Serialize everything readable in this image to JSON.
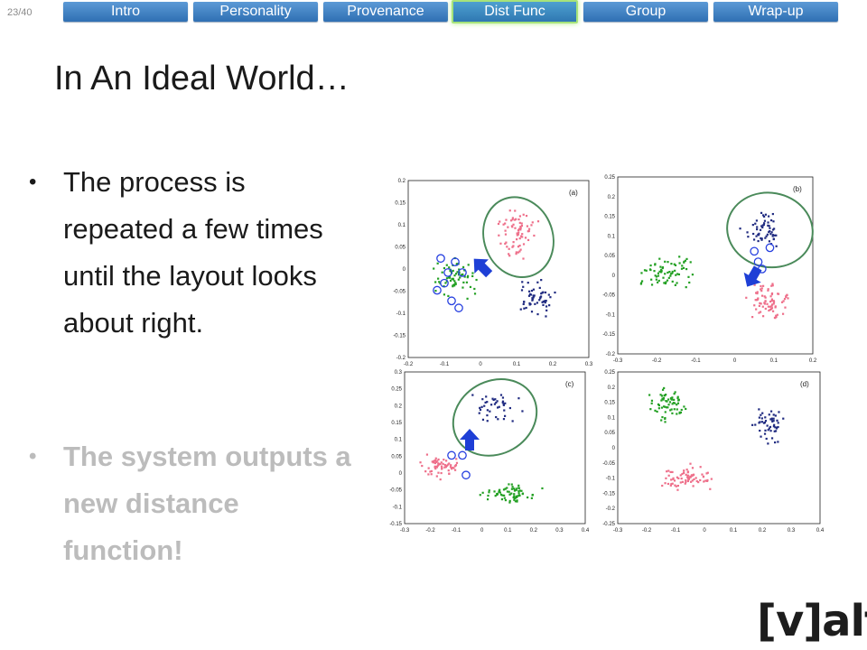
{
  "slide_number": "23/40",
  "nav": {
    "tabs": [
      {
        "label": "Intro",
        "active": false
      },
      {
        "label": "Personality",
        "active": false
      },
      {
        "label": "Provenance",
        "active": false
      },
      {
        "label": "Dist Func",
        "active": true
      },
      {
        "label": "Group",
        "active": false
      },
      {
        "label": "Wrap-up",
        "active": false
      }
    ]
  },
  "title": "In An Ideal World…",
  "bullets": [
    {
      "text": "The process is repeated a few times until the layout looks about right.",
      "dimmed": false
    },
    {
      "text": "The system outputs a new distance function!",
      "dimmed": true
    }
  ],
  "logo": "[v]alt",
  "figure": {
    "colors": {
      "red": "#ee6f8a",
      "green": "#23a023",
      "navy": "#1f2a80",
      "ellipse": "#4a8a5a",
      "arrow": "#1e3fd6",
      "highlight": "#2740e0"
    },
    "panels": [
      {
        "label": "(a)",
        "xticks": [
          "-0.2",
          "-0.1",
          "0",
          "0.1",
          "0.2",
          "0.3"
        ],
        "yticks": [
          "0.2",
          "0.15",
          "0.1",
          "0.05",
          "0",
          "-0.05",
          "-0.1",
          "-0.15",
          "-0.2"
        ]
      },
      {
        "label": "(b)",
        "xticks": [
          "-0.3",
          "-0.2",
          "-0.1",
          "0",
          "0.1",
          "0.2"
        ],
        "yticks": [
          "0.25",
          "0.2",
          "0.15",
          "0.1",
          "0.05",
          "0",
          "-0.05",
          "-0.1",
          "-0.15",
          "-0.2"
        ]
      },
      {
        "label": "(c)",
        "xticks": [
          "-0.3",
          "-0.2",
          "-0.1",
          "0",
          "0.1",
          "0.2",
          "0.3",
          "0.4"
        ],
        "yticks": [
          "0.3",
          "0.25",
          "0.2",
          "0.15",
          "0.1",
          "0.05",
          "0",
          "-0.05",
          "-0.1",
          "-0.15"
        ]
      },
      {
        "label": "(d)",
        "xticks": [
          "-0.3",
          "-0.2",
          "-0.1",
          "0",
          "0.1",
          "0.2",
          "0.3",
          "0.4"
        ],
        "yticks": [
          "0.25",
          "0.2",
          "0.15",
          "0.1",
          "0.05",
          "0",
          "-0.05",
          "-0.1",
          "-0.15",
          "-0.2",
          "-0.25"
        ]
      }
    ]
  }
}
